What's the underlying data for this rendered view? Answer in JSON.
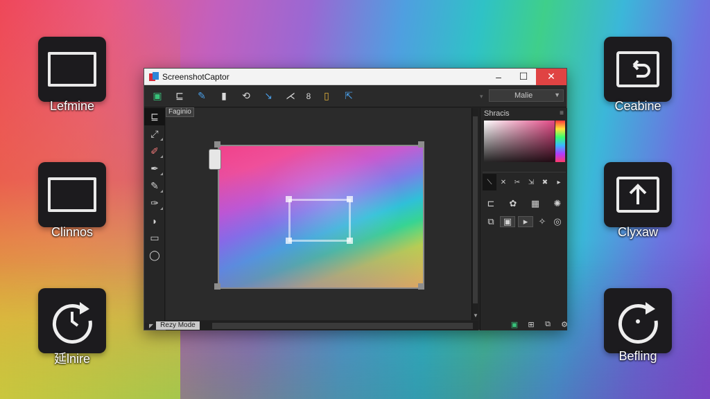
{
  "desktop": {
    "icons": [
      {
        "label": "Lefmine",
        "glyph": "rectangle-icon"
      },
      {
        "label": "Clinnos",
        "glyph": "rectangle-icon"
      },
      {
        "label": "延lnire",
        "glyph": "refresh-icon"
      },
      {
        "label": "Ceabine",
        "glyph": "back-arrow-icon"
      },
      {
        "label": "Clyxaw",
        "glyph": "upload-arrow-icon"
      },
      {
        "label": "Befling",
        "glyph": "refresh-icon"
      }
    ]
  },
  "window": {
    "title": "ScreenshotCaptor",
    "controls": {
      "minimize": "–",
      "maximize": "☐",
      "close": "✕"
    }
  },
  "toolbar": {
    "count_label": "8",
    "mode_select": "Malie"
  },
  "canvas": {
    "tooltip": "Faginio"
  },
  "status": {
    "mode_label": "Rezy Mode"
  },
  "right_panel": {
    "header": "Shracis"
  },
  "colors": {
    "window_bg": "#232323",
    "close_button": "#e04343",
    "accent_blue": "#4a9fe8"
  }
}
